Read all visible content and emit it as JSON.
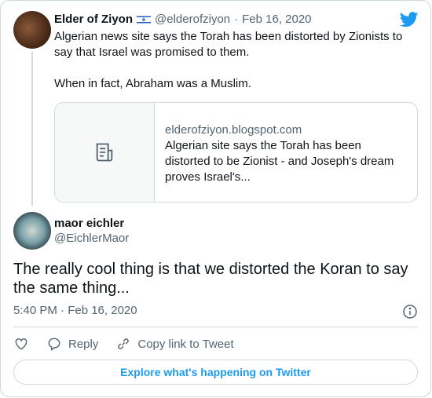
{
  "quoted": {
    "name": "Elder of Ziyon",
    "handle": "@elderofziyon",
    "sep": "·",
    "date": "Feb 16, 2020",
    "body": [
      "Algerian news site says the Torah has been distorted by Zionists to say that Israel was promised to them.",
      "When in fact, Abraham was a Muslim."
    ],
    "link": {
      "domain": "elderofziyon.blogspot.com",
      "title": "Algerian site says the Torah has been distorted to be Zionist - and Joseph's dream proves Israel's..."
    }
  },
  "tweet": {
    "name": "maor eichler",
    "handle": "@EichlerMaor",
    "text": "The really cool thing is that we distorted the Koran to say the same thing...",
    "timestamp": "5:40 PM · Feb 16, 2020"
  },
  "actions": {
    "reply": "Reply",
    "copy_link": "Copy link to Tweet"
  },
  "explore_label": "Explore what's happening on Twitter",
  "colors": {
    "accent": "#1d9bf0",
    "muted": "#536471",
    "border": "#cfd9de"
  }
}
